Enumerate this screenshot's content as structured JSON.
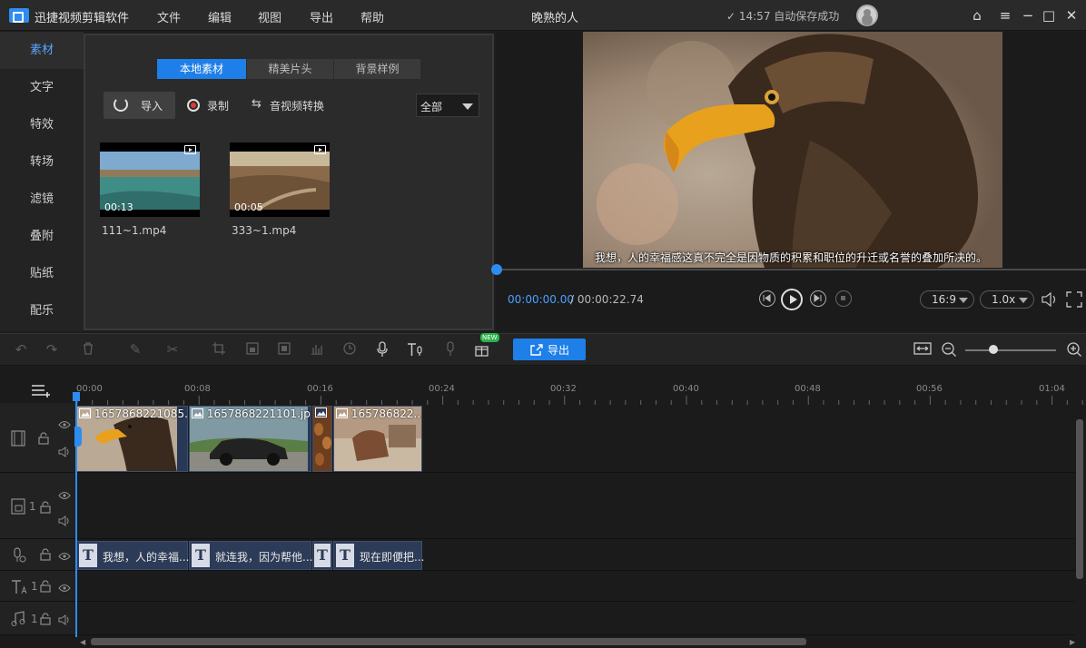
{
  "app": {
    "name": "迅捷视频剪辑软件",
    "menu": [
      "文件",
      "编辑",
      "视图",
      "导出",
      "帮助"
    ],
    "doc_title": "晚熟的人",
    "save_status": "✓ 14:57 自动保存成功"
  },
  "window_controls": {
    "home": "⌂",
    "menu": "≡",
    "minimize": "−",
    "maximize": "□",
    "close": "✕"
  },
  "sidebar": {
    "items": [
      {
        "label": "素材",
        "active": true
      },
      {
        "label": "文字"
      },
      {
        "label": "特效"
      },
      {
        "label": "转场"
      },
      {
        "label": "滤镜"
      },
      {
        "label": "叠附"
      },
      {
        "label": "贴纸"
      },
      {
        "label": "配乐"
      }
    ]
  },
  "media": {
    "tabs": [
      {
        "label": "本地素材",
        "active": true
      },
      {
        "label": "精美片头"
      },
      {
        "label": "背景样例"
      }
    ],
    "import_label": "导入",
    "record_label": "录制",
    "convert_label": "音视频转换",
    "filter": "全部",
    "files": [
      {
        "name": "111~1.mp4",
        "duration": "00:13"
      },
      {
        "name": "333~1.mp4",
        "duration": "00:05"
      }
    ]
  },
  "preview": {
    "subtitle": "我想，人的幸福感这真不完全是因物质的积累和职位的升迁或名誉的叠加所决的。",
    "time_current": "00:00:00.00",
    "time_total": "/ 00:00:22.74",
    "progress": 0,
    "aspect": "16:9",
    "speed": "1.0x"
  },
  "toolbar": {
    "export_label": "导出",
    "new_badge": "NEW",
    "zoom_level": 0.3
  },
  "timeline": {
    "ruler": [
      "00:00",
      "00:08",
      "00:16",
      "00:24",
      "00:32",
      "00:40",
      "00:48",
      "00:56",
      "01:04"
    ],
    "video_clips": [
      {
        "label": "1657868221085..."
      },
      {
        "label": "1657868221101.jpg"
      },
      {
        "label": ""
      },
      {
        "label": "165786822..."
      }
    ],
    "subtitle_clips": [
      {
        "text": "我想，人的幸福..."
      },
      {
        "text": "就连我，因为帮他..."
      },
      {
        "text": ""
      },
      {
        "text": "现在即便把..."
      }
    ],
    "track_numbers": [
      "1",
      "1",
      "1"
    ]
  },
  "colors": {
    "accent": "#2d8cf0",
    "export": "#1e7fe8",
    "record": "#e53935",
    "new_badge": "#2bb24c"
  }
}
